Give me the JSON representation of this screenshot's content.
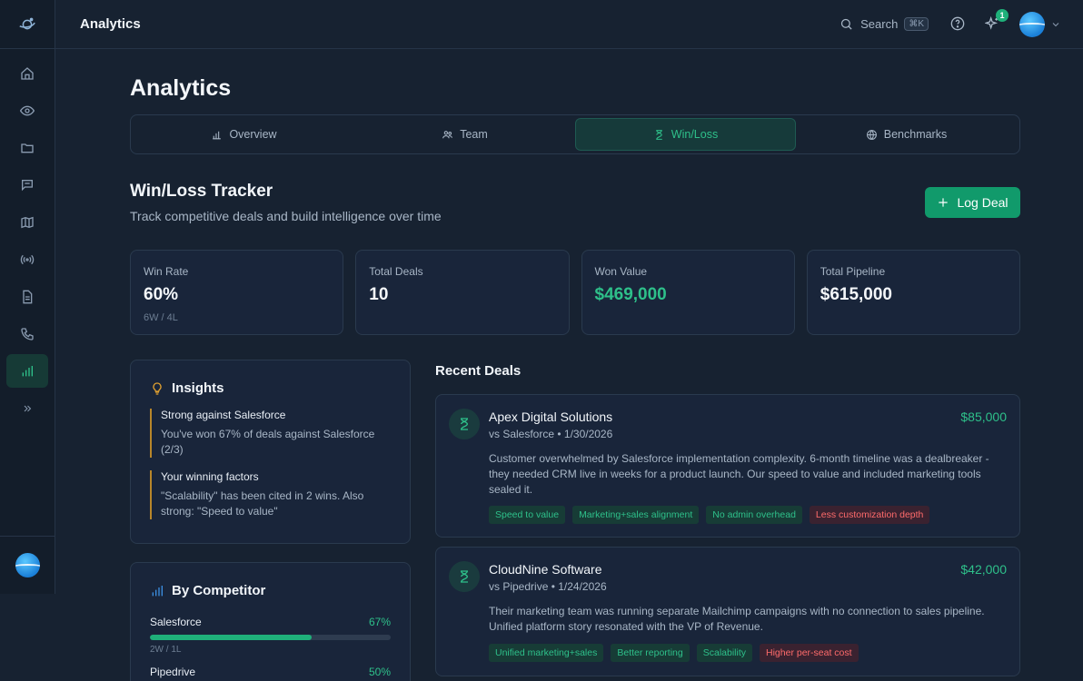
{
  "app": {
    "header_title": "Analytics"
  },
  "topbar": {
    "search_label": "Search",
    "search_shortcut": "⌘K",
    "notification_count": "1"
  },
  "sidebar": {
    "items": [
      {
        "name": "home",
        "icon": "home-icon"
      },
      {
        "name": "watch",
        "icon": "eye-icon"
      },
      {
        "name": "files",
        "icon": "folder-icon"
      },
      {
        "name": "messages",
        "icon": "chat-icon"
      },
      {
        "name": "map",
        "icon": "map-icon"
      },
      {
        "name": "signals",
        "icon": "broadcast-icon"
      },
      {
        "name": "documents",
        "icon": "document-icon"
      },
      {
        "name": "calls",
        "icon": "phone-icon"
      },
      {
        "name": "analytics",
        "icon": "bar-chart-icon",
        "active": true
      },
      {
        "name": "expand",
        "icon": "double-chevron-right-icon"
      }
    ]
  },
  "page": {
    "title": "Analytics",
    "tabs": [
      {
        "label": "Overview",
        "icon": "bar-chart-icon"
      },
      {
        "label": "Team",
        "icon": "users-icon"
      },
      {
        "label": "Win/Loss",
        "icon": "hourglass-icon",
        "active": true
      },
      {
        "label": "Benchmarks",
        "icon": "globe-icon"
      }
    ],
    "section_title": "Win/Loss Tracker",
    "section_subtitle": "Track competitive deals and build intelligence over time",
    "log_button": "Log Deal"
  },
  "stats": [
    {
      "label": "Win Rate",
      "value": "60%",
      "sub": "6W / 4L"
    },
    {
      "label": "Total Deals",
      "value": "10"
    },
    {
      "label": "Won Value",
      "value": "$469,000"
    },
    {
      "label": "Total Pipeline",
      "value": "$615,000"
    }
  ],
  "insights": {
    "title": "Insights",
    "items": [
      {
        "heading": "Strong against Salesforce",
        "body": "You've won 67% of deals against Salesforce (2/3)"
      },
      {
        "heading": "Your winning factors",
        "body": "\"Scalability\" has been cited in 2 wins. Also strong: \"Speed to value\""
      }
    ]
  },
  "by_competitor": {
    "title": "By Competitor",
    "rows": [
      {
        "name": "Salesforce",
        "pct": "67%",
        "record": "2W / 1L",
        "fraction": 0.67
      },
      {
        "name": "Pipedrive",
        "pct": "50%"
      }
    ]
  },
  "recent_deals": {
    "title": "Recent Deals",
    "deals": [
      {
        "name": "Apex Digital Solutions",
        "meta": "vs Salesforce • 1/30/2026",
        "value": "$85,000",
        "description": "Customer overwhelmed by Salesforce implementation complexity. 6-month timeline was a dealbreaker - they needed CRM live in weeks for a product launch. Our speed to value and included marketing tools sealed it.",
        "tags": [
          "Speed to value",
          "Marketing+sales alignment",
          "No admin overhead",
          "Less customization depth"
        ]
      },
      {
        "name": "CloudNine Software",
        "meta": "vs Pipedrive • 1/24/2026",
        "value": "$42,000",
        "description": "Their marketing team was running separate Mailchimp campaigns with no connection to sales pipeline. Unified platform story resonated with the VP of Revenue.",
        "tags": [
          "Unified marketing+sales",
          "Better reporting",
          "Scalability",
          "Higher per-seat cost"
        ]
      }
    ]
  },
  "colors": {
    "accent": "#2ec08a",
    "button": "#119a6b",
    "negative": "#ff6b6b",
    "insight_border": "#b8862a"
  }
}
